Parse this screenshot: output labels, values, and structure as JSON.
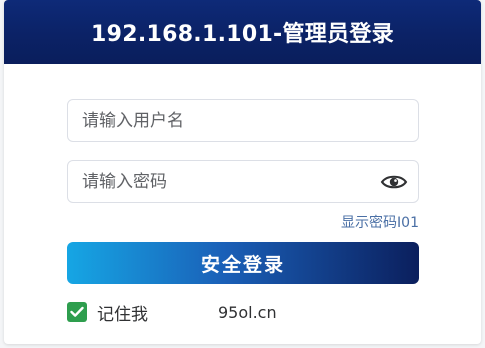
{
  "header": {
    "title": "192.168.1.101-管理员登录"
  },
  "form": {
    "username_placeholder": "请输入用户名",
    "password_placeholder": "请输入密码",
    "show_password_label": "显示密码I01",
    "login_button_label": "安全登录",
    "remember_label": "记住我",
    "remember_checked": true
  },
  "footer": {
    "site_text": "95ol.cn"
  },
  "colors": {
    "header_bg": "#0b2266",
    "button_gradient_start": "#16a6e4",
    "button_gradient_end": "#0b1f5d",
    "checkbox_bg": "#2e9e4e",
    "link_color": "#4a6fa5"
  },
  "icons": {
    "eye": "eye-icon",
    "check": "check-icon"
  }
}
